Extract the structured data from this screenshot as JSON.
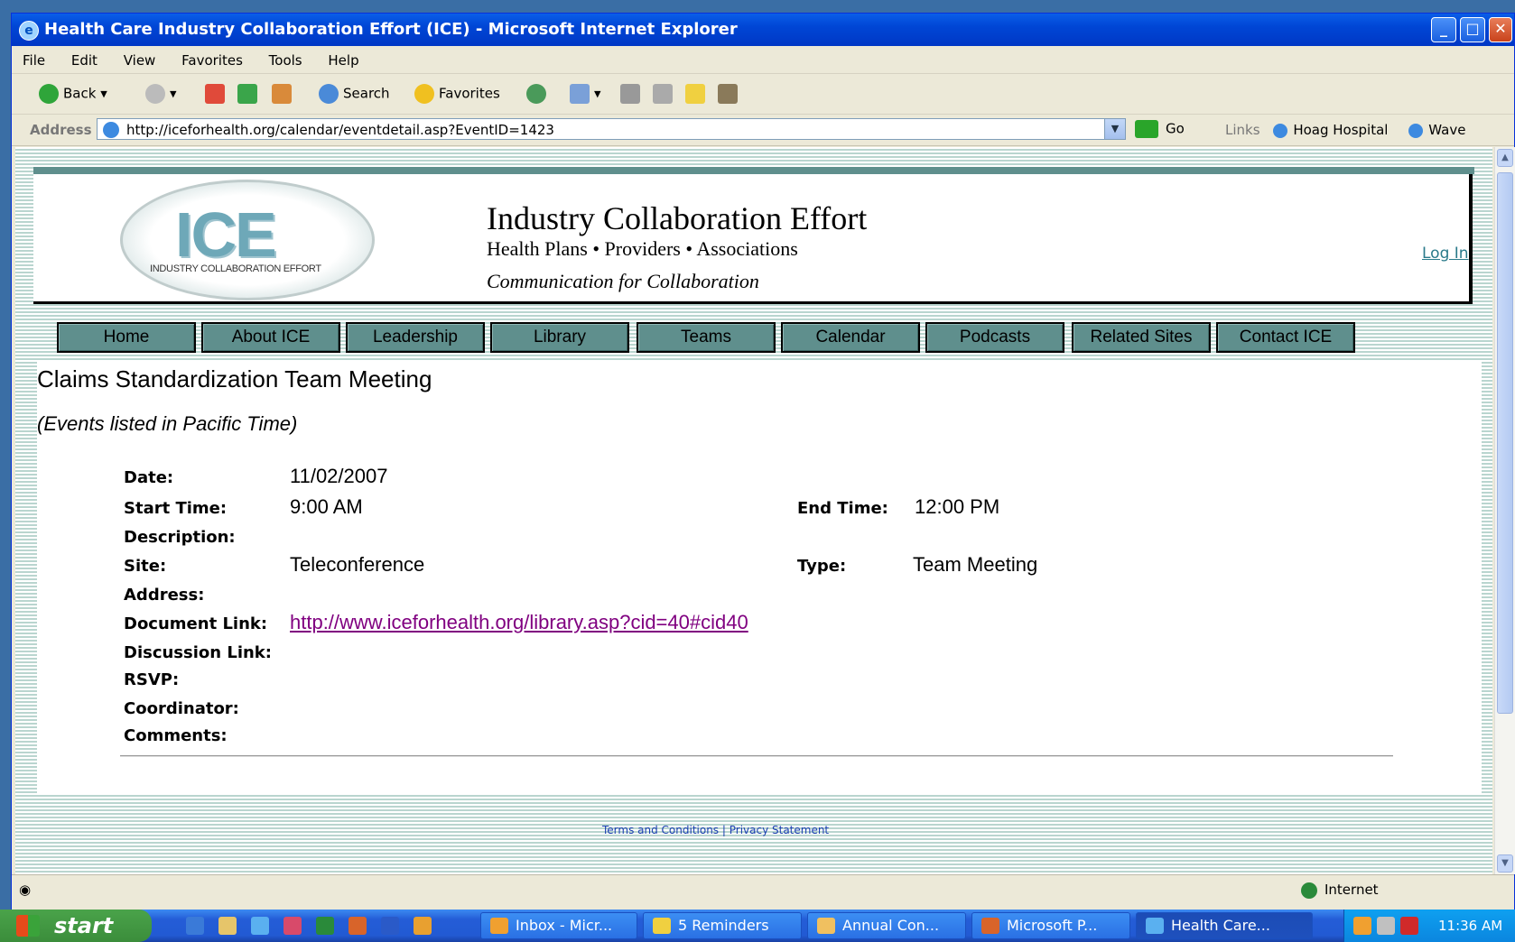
{
  "window": {
    "title": "Health Care Industry Collaboration Effort (ICE) - Microsoft Internet Explorer",
    "controls": [
      "_",
      "□",
      "✕"
    ]
  },
  "menu": [
    "File",
    "Edit",
    "View",
    "Favorites",
    "Tools",
    "Help"
  ],
  "toolbar": {
    "back": "Back",
    "search": "Search",
    "favorites": "Favorites"
  },
  "address": {
    "label": "Address",
    "url": "http://iceforhealth.org/calendar/eventdetail.asp?EventID=1423",
    "go": "Go",
    "links_label": "Links",
    "links": [
      "Hoag Hospital",
      "Wave"
    ]
  },
  "site": {
    "logo_text": "ICE",
    "logo_sub": "INDUSTRY COLLABORATION EFFORT",
    "title": "Industry Collaboration Effort",
    "subtitle": "Health Plans • Providers • Associations",
    "tagline": "Communication for Collaboration",
    "login": "Log In"
  },
  "nav": [
    "Home",
    "About ICE",
    "Leadership",
    "Library",
    "Teams",
    "Calendar",
    "Podcasts",
    "Related Sites",
    "Contact ICE"
  ],
  "event": {
    "title": "Claims Standardization Team Meeting",
    "timezone_note": "(Events listed in Pacific Time)",
    "labels": {
      "date": "Date:",
      "start": "Start Time:",
      "end": "End Time:",
      "description": "Description:",
      "site": "Site:",
      "type": "Type:",
      "address": "Address:",
      "doc": "Document Link:",
      "discussion": "Discussion Link:",
      "rsvp": "RSVP:",
      "coordinator": "Coordinator:",
      "comments": "Comments:"
    },
    "date": "11/02/2007",
    "start_time": "9:00 AM",
    "end_time": "12:00 PM",
    "site": "Teleconference",
    "type": "Team Meeting",
    "doc_link": "http://www.iceforhealth.org/library.asp?cid=40#cid40"
  },
  "footer_partial": "Terms and Conditions | Privacy Statement",
  "status": {
    "zone": "Internet"
  },
  "taskbar": {
    "start": "start",
    "tasks": [
      "Inbox - Micr...",
      "5 Reminders",
      "Annual Con...",
      "Microsoft P...",
      "Health Care..."
    ],
    "clock": "11:36 AM"
  }
}
